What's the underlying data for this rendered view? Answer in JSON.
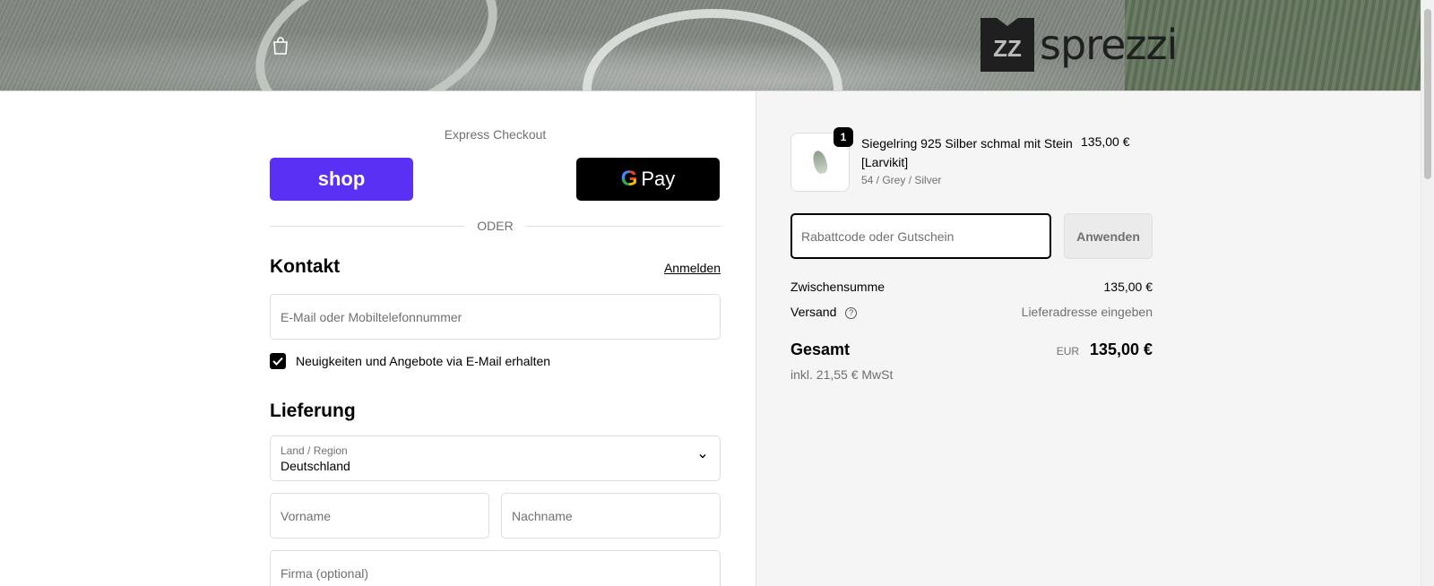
{
  "header": {
    "logo_mark": "ZZ",
    "logo_word": "sprezzi",
    "cart_icon": "shopping-bag-icon"
  },
  "express": {
    "title": "Express Checkout",
    "shop_label": "shop",
    "gpay_g": "G",
    "gpay_label": "Pay",
    "divider": "ODER"
  },
  "contact": {
    "title": "Kontakt",
    "login_link": "Anmelden",
    "email_placeholder": "E-Mail oder Mobiltelefonnummer",
    "newsletter_label": "Neuigkeiten und Angebote via E-Mail erhalten",
    "newsletter_checked": true
  },
  "delivery": {
    "title": "Lieferung",
    "country_label": "Land / Region",
    "country_value": "Deutschland",
    "first_name_placeholder": "Vorname",
    "last_name_placeholder": "Nachname",
    "company_placeholder": "Firma (optional)"
  },
  "order": {
    "item": {
      "quantity": "1",
      "name": "Siegelring 925 Silber schmal mit Stein [Larvikit]",
      "variant": "54 / Grey / Silver",
      "price": "135,00 €"
    },
    "discount_placeholder": "Rabattcode oder Gutschein",
    "apply_label": "Anwenden",
    "subtotal_label": "Zwischensumme",
    "subtotal_value": "135,00 €",
    "shipping_label": "Versand",
    "shipping_value": "Lieferadresse eingeben",
    "total_label": "Gesamt",
    "total_currency": "EUR",
    "total_value": "135,00 €",
    "tax_note": "inkl. 21,55 € MwSt"
  },
  "colors": {
    "shop_pay": "#5a31f4",
    "gpay": "#000000",
    "muted_text": "#707070",
    "summary_bg": "#f5f5f5"
  }
}
